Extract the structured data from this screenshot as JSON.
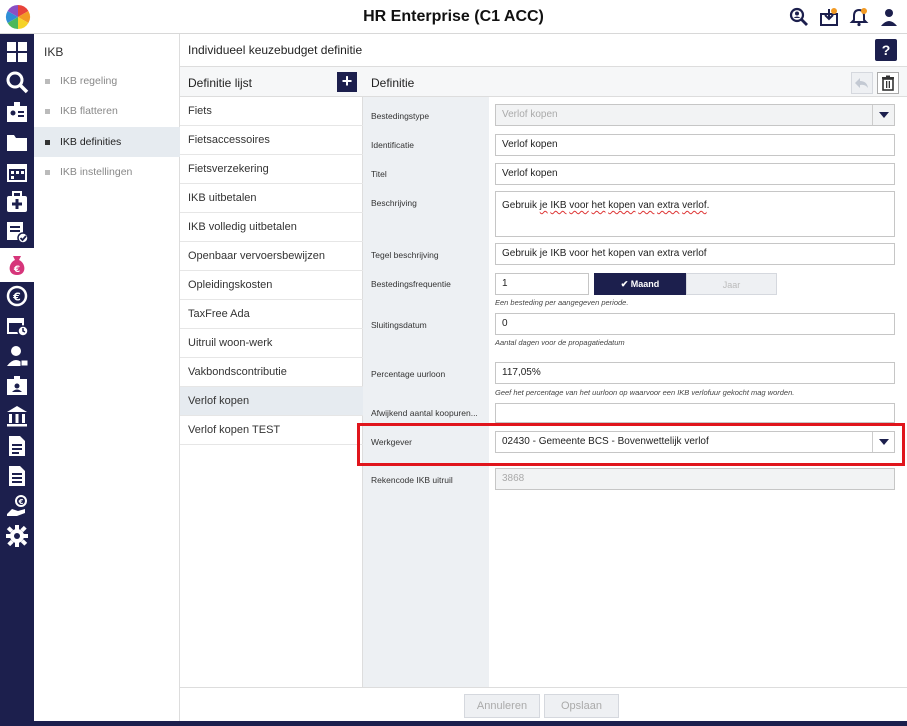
{
  "app": {
    "title": "HR Enterprise (C1 ACC)"
  },
  "icons": {
    "logo": "color-wheel-logo",
    "header": [
      "search-people-icon",
      "import-icon",
      "notification-bell-icon",
      "user-icon"
    ]
  },
  "rail": {
    "items": [
      "dashboard-icon",
      "search-icon",
      "badge-icon",
      "folder-icon",
      "calendar-icon",
      "medical-icon",
      "checklist-icon",
      "money-bag-icon",
      "euro-refresh-icon",
      "calendar-clock-icon",
      "person-icon",
      "id-card-icon",
      "institution-icon",
      "document-icon",
      "report-icon",
      "hand-money-icon",
      "settings-gear-icon"
    ]
  },
  "subnav": {
    "title": "IKB",
    "items": [
      {
        "label": "IKB regeling",
        "active": false
      },
      {
        "label": "IKB flatteren",
        "active": false
      },
      {
        "label": "IKB definities",
        "active": true
      },
      {
        "label": "IKB instellingen",
        "active": false
      }
    ]
  },
  "page": {
    "title": "Individueel keuzebudget definitie",
    "help_label": "?"
  },
  "list": {
    "title": "Definitie lijst",
    "add_label": "+",
    "items": [
      {
        "label": "Fiets",
        "active": false
      },
      {
        "label": "Fietsaccessoires",
        "active": false
      },
      {
        "label": "Fietsverzekering",
        "active": false
      },
      {
        "label": "IKB uitbetalen",
        "active": false
      },
      {
        "label": "IKB volledig uitbetalen",
        "active": false
      },
      {
        "label": "Openbaar vervoersbewijzen",
        "active": false
      },
      {
        "label": "Opleidingskosten",
        "active": false
      },
      {
        "label": "TaxFree Ada",
        "active": false
      },
      {
        "label": "Uitruil woon-werk",
        "active": false
      },
      {
        "label": "Vakbondscontributie",
        "active": false
      },
      {
        "label": "Verlof kopen",
        "active": true
      },
      {
        "label": "Verlof kopen TEST",
        "active": false
      }
    ]
  },
  "detail": {
    "title": "Definitie",
    "fields": {
      "bestedingstype": {
        "label": "Bestedingstype",
        "value": "Verlof kopen"
      },
      "identificatie": {
        "label": "Identificatie",
        "value": "Verlof kopen"
      },
      "titel": {
        "label": "Titel",
        "value": "Verlof kopen"
      },
      "beschrijving": {
        "label": "Beschrijving",
        "value_pre": "Gebruik ",
        "value_sp1": "je",
        "value_mid1": " ",
        "value_sp2": "IKB",
        "value_mid2": " ",
        "value_sp3": "voor",
        "value_mid3": " ",
        "value_sp4": "het",
        "value_mid4": " ",
        "value_sp5": "kopen",
        "value_mid5": " ",
        "value_sp6": "van",
        "value_mid6": " ",
        "value_sp7": "extra",
        "value_mid7": " ",
        "value_sp8": "verlof",
        "value_post": "."
      },
      "tegel": {
        "label": "Tegel beschrijving",
        "value": "Gebruik je IKB voor het kopen van extra verlof"
      },
      "frequentie": {
        "label": "Bestedingsfrequentie",
        "value": "1",
        "option_on": "Maand",
        "option_off": "Jaar",
        "help": "Een besteding per aangegeven periode."
      },
      "sluitingsdatum": {
        "label": "Sluitingsdatum",
        "value": "0",
        "help": "Aantal dagen voor de propagatiedatum"
      },
      "percentage": {
        "label": "Percentage uurloon",
        "value": "117,05%",
        "help": "Geef het percentage van het uurloon op waarvoor een IKB verlofuur gekocht mag worden."
      },
      "afwijkend": {
        "label": "Afwijkend aantal koopuren...",
        "value": ""
      },
      "werkgever": {
        "label": "Werkgever",
        "value": "02430 - Gemeente BCS - Bovenwettelijk verlof"
      },
      "rekencode": {
        "label": "Rekencode IKB uitruil",
        "value": "3868"
      }
    }
  },
  "footer": {
    "cancel_label": "Annuleren",
    "save_label": "Opslaan"
  },
  "colors": {
    "navy": "#1c1f4d",
    "highlight": "#e0151c"
  }
}
